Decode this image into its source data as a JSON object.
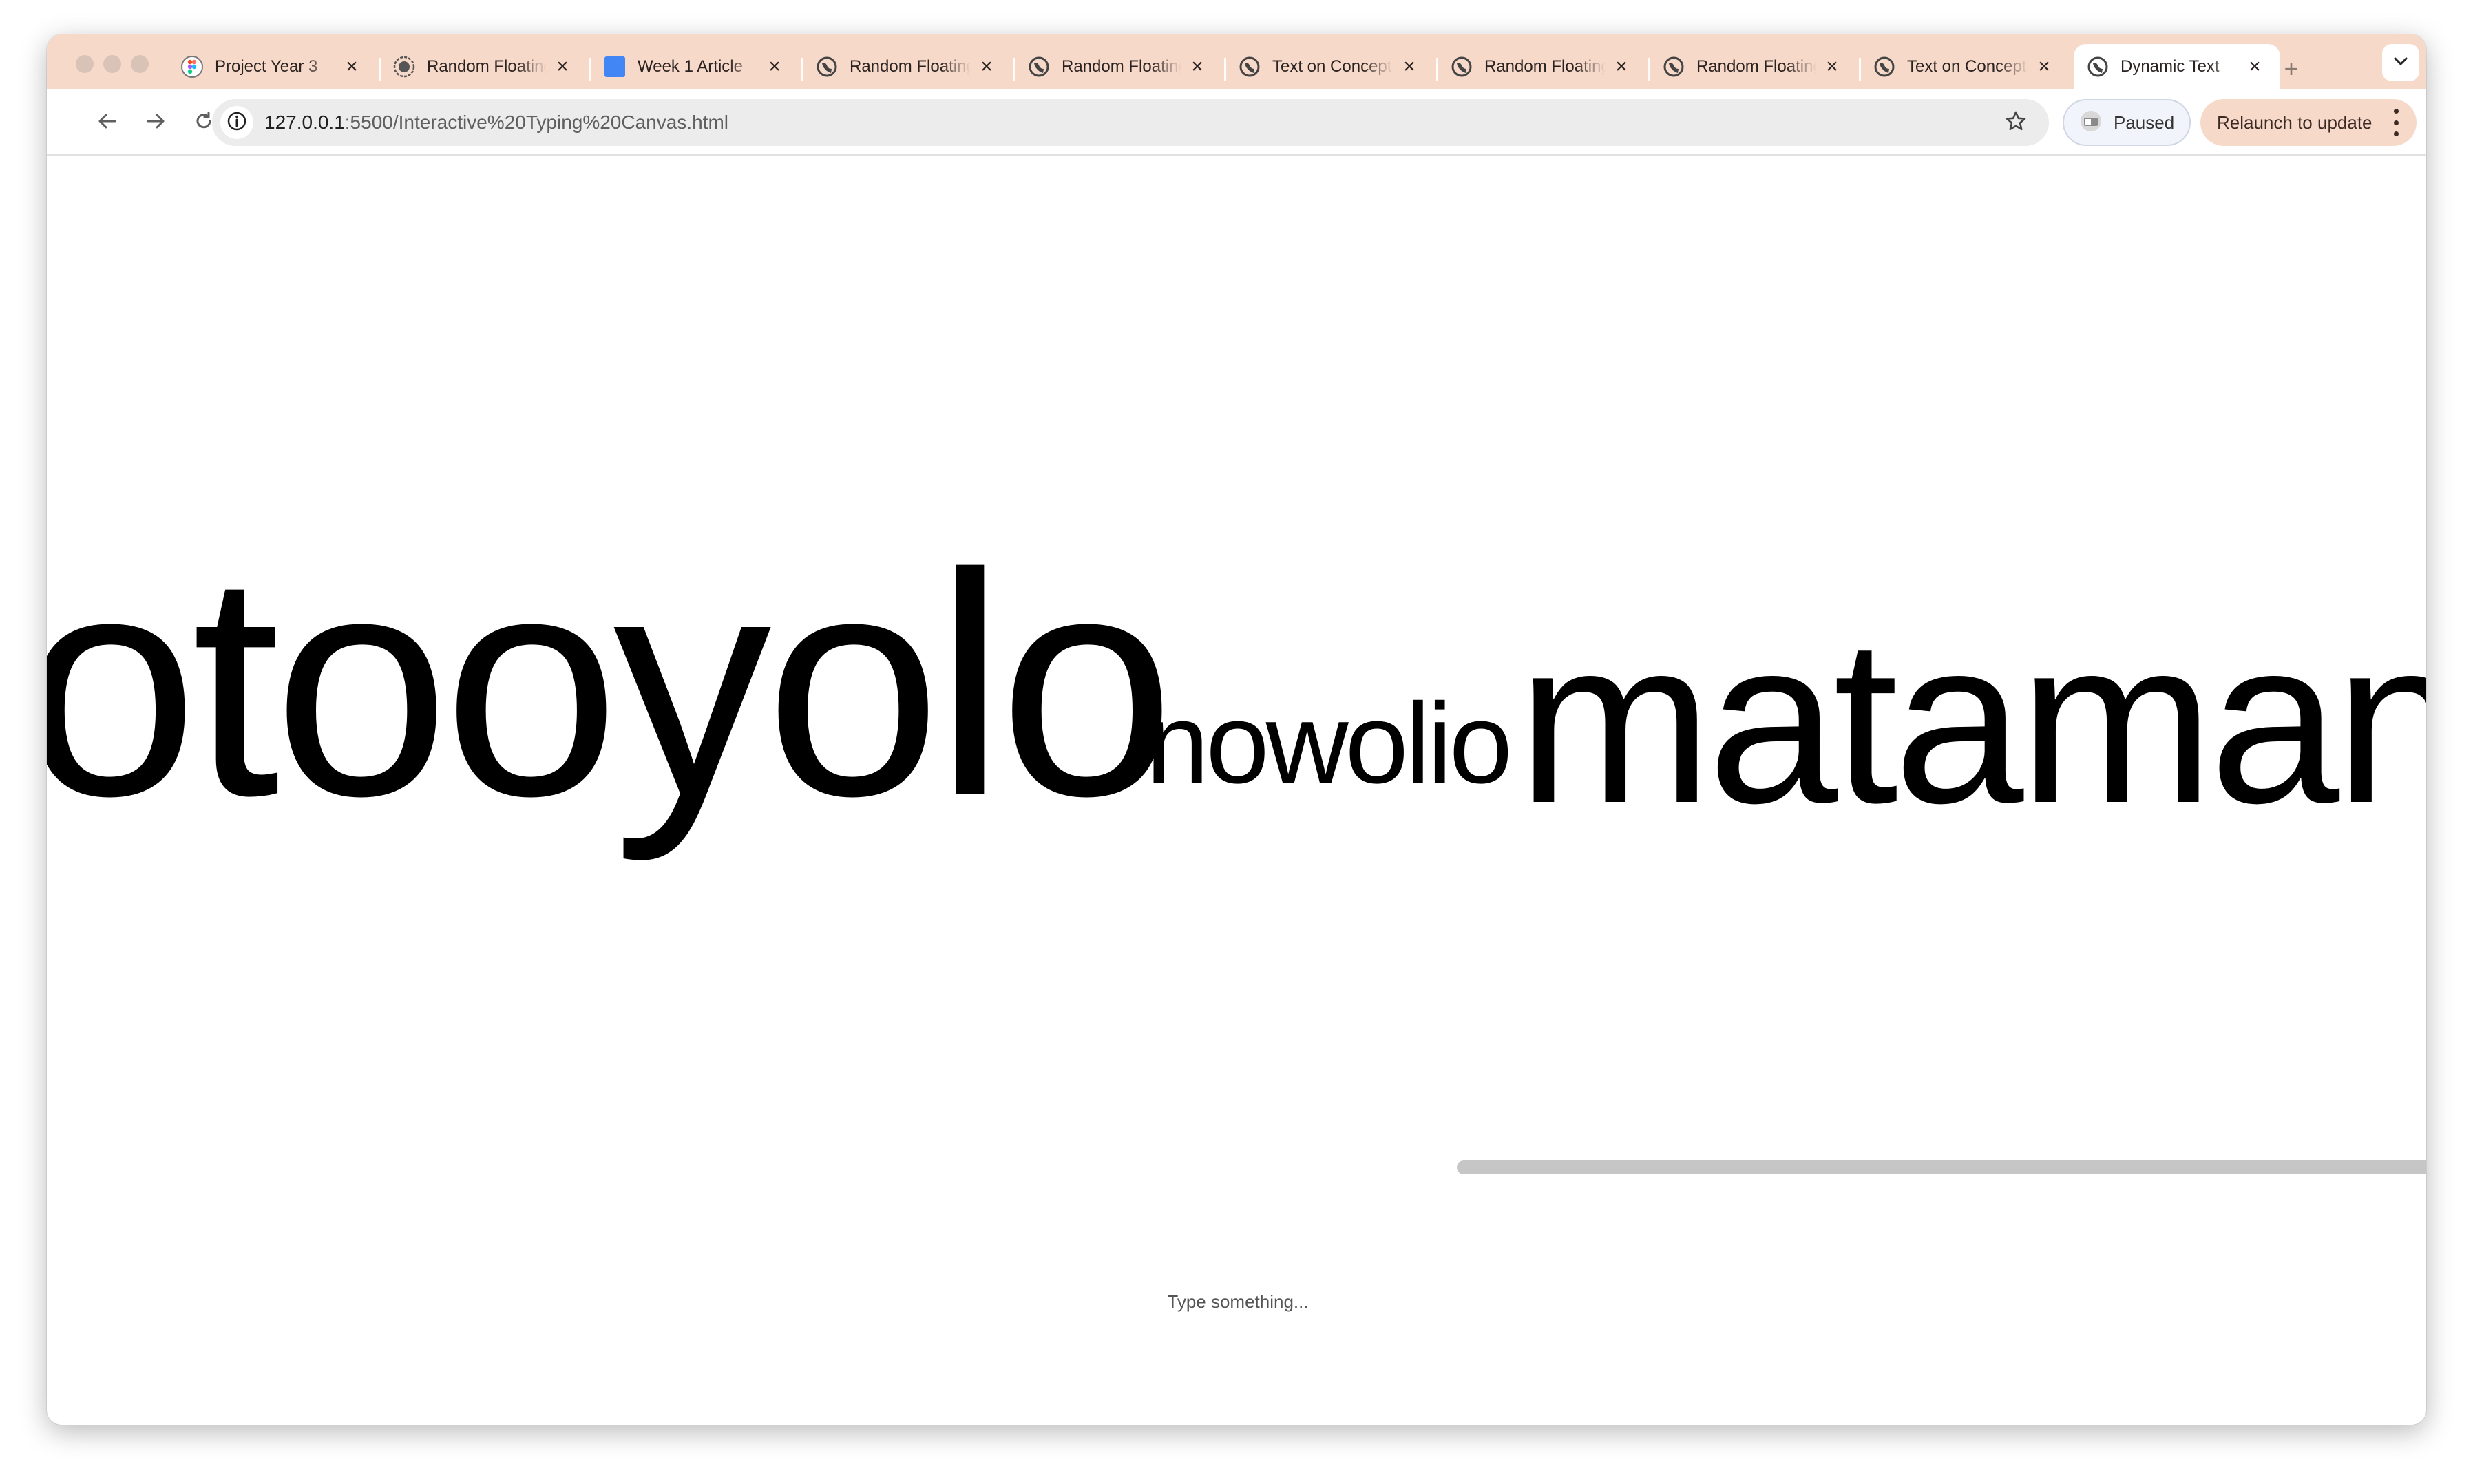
{
  "browser": {
    "tabs": [
      {
        "title": "Project Year 3",
        "favicon": "figma-icon",
        "active": false
      },
      {
        "title": "Random Floating",
        "favicon": "globe-icon",
        "active": false
      },
      {
        "title": "Week 1 Article",
        "favicon": "doc-icon",
        "active": false
      },
      {
        "title": "Random Floating",
        "favicon": "globe-icon",
        "active": false
      },
      {
        "title": "Random Floating",
        "favicon": "globe-icon",
        "active": false
      },
      {
        "title": "Text on Concept",
        "favicon": "globe-icon",
        "active": false
      },
      {
        "title": "Random Floating",
        "favicon": "globe-icon",
        "active": false
      },
      {
        "title": "Random Floating",
        "favicon": "globe-icon",
        "active": false
      },
      {
        "title": "Text on Concept",
        "favicon": "globe-icon",
        "active": false
      },
      {
        "title": "Dynamic Text",
        "favicon": "globe-icon",
        "active": true
      }
    ],
    "close_glyph": "×",
    "new_tab_glyph": "+",
    "address": {
      "host": "127.0.0.1",
      "path": ":5500/Interactive%20Typing%20Canvas.html"
    },
    "profile_chip_label": "Paused",
    "update_chip_label": "Relaunch to update",
    "colors": {
      "tabstrip": "#f7d9c9",
      "omnibox": "#ececec"
    }
  },
  "canvas": {
    "words": [
      "otooyolo",
      "nowolio",
      "mataman"
    ],
    "input_placeholder": "Type something..."
  }
}
